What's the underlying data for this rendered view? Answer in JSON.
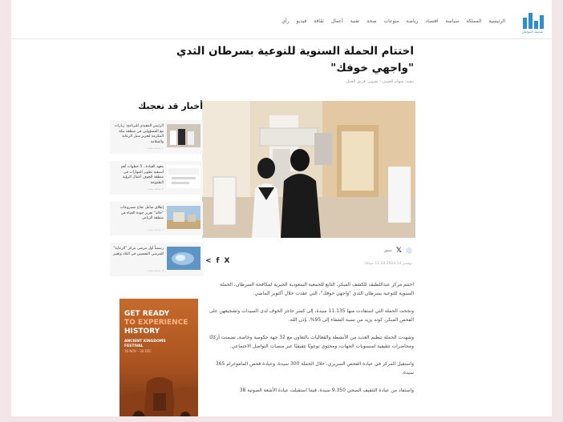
{
  "header": {
    "logo_caption": "صحيفة المواطن",
    "nav": [
      "الرئيسية",
      "المملكة",
      "سياسة",
      "اقتصاد",
      "رياضة",
      "منوعات",
      "صحة",
      "تقنية",
      "أعمال",
      "ثقافة",
      "فيديو",
      "رأي"
    ]
  },
  "article": {
    "title": "اختتام الحملة السنوية للتوعية بسرطان الثدي \"واجهي خوفك\"",
    "byline": "تنفيذ: سهام العتيبي - تصوير: فريق العمل",
    "source_name": "سبق",
    "date": "نوفمبر 14 2024 11:24 صباحًا",
    "paragraphs": [
      "اختتم مركز عبداللطيف للكشف المبكر، التابع للجمعية السعودية الخيرية لمكافحة السرطان، الحملة السنوية للتوعية بسرطان الثدي \"واجهي خوفك\"، التي عقدت خلال أكتوبر الماضي.",
      "ونجحت الحملة التي استفادت منها 11.135 سيدة، إلى كسر حاجز الخوف لدى السيدات وتشجيعهن على الفحص المبكر، كونه يزيد من نسبة الشفاء إلى 95%، بإذن الله.",
      "وشهدت الحملة تنظيم العديد من الأنشطة والفعاليات بالتعاون مع 32 جهة حكومية وخاصة، تضمنت أركانًا ومحاضرات تثقيفية لمنسوبات الجهات، ومحتوى توعويًا تثقيفيًا عبر منصات التواصل الاجتماعي.",
      "واستقبل المركز في عيادة الفحص السريري، خلال الحملة 300 سيدة، وعيادة فحص الماموغرام 365 سيدة.",
      "واستفاد من عيادة التثقيف الصحي 9.350 سيدة، فيما استقبلت عيادة الأشعة الصوتية 38"
    ]
  },
  "sidebar": {
    "heading": "أخبار قد تعجبك",
    "cards": [
      {
        "title": "الرئيس التنفيذي للبرنامج: زيارات مع المسؤولين في منطقة مكة المكرمة لتعزيز سبل الرعاية والسلامة",
        "date": "1 ساعة مضت"
      },
      {
        "title": "معهد القيادة.. 5 خطوات أهم أسبقية تطوير المهارات في منطقة الجوف أعمال الرؤية الطموحة",
        "date": "2 ساعة مضت"
      },
      {
        "title": "إطلاق شامل نجاح مشروعات \"حالة\" تعزيز جودة الحياة في منطقة الرياض",
        "date": "3 ساعة مضت"
      },
      {
        "title": "رسمياً أول مرضى مركز \"الرعاية\" للمرضى النفسيين في البلاد وتغيير",
        "date": "4 ساعة مضت"
      }
    ]
  },
  "ad": {
    "line1": "GET READY",
    "line2": "TO EXPERIENCE",
    "line3": "HISTORY",
    "line4": "ANCIENT KINGDOMS",
    "line5": "FESTIVAL",
    "line6": "16 NOV - 30 DEC"
  },
  "share": {
    "x": "X",
    "f": "f",
    "share": "<"
  },
  "colors": {
    "brand": "#2d8fd0",
    "ad_orange": "#c56a2c",
    "page_bg": "#f3e6e9"
  }
}
